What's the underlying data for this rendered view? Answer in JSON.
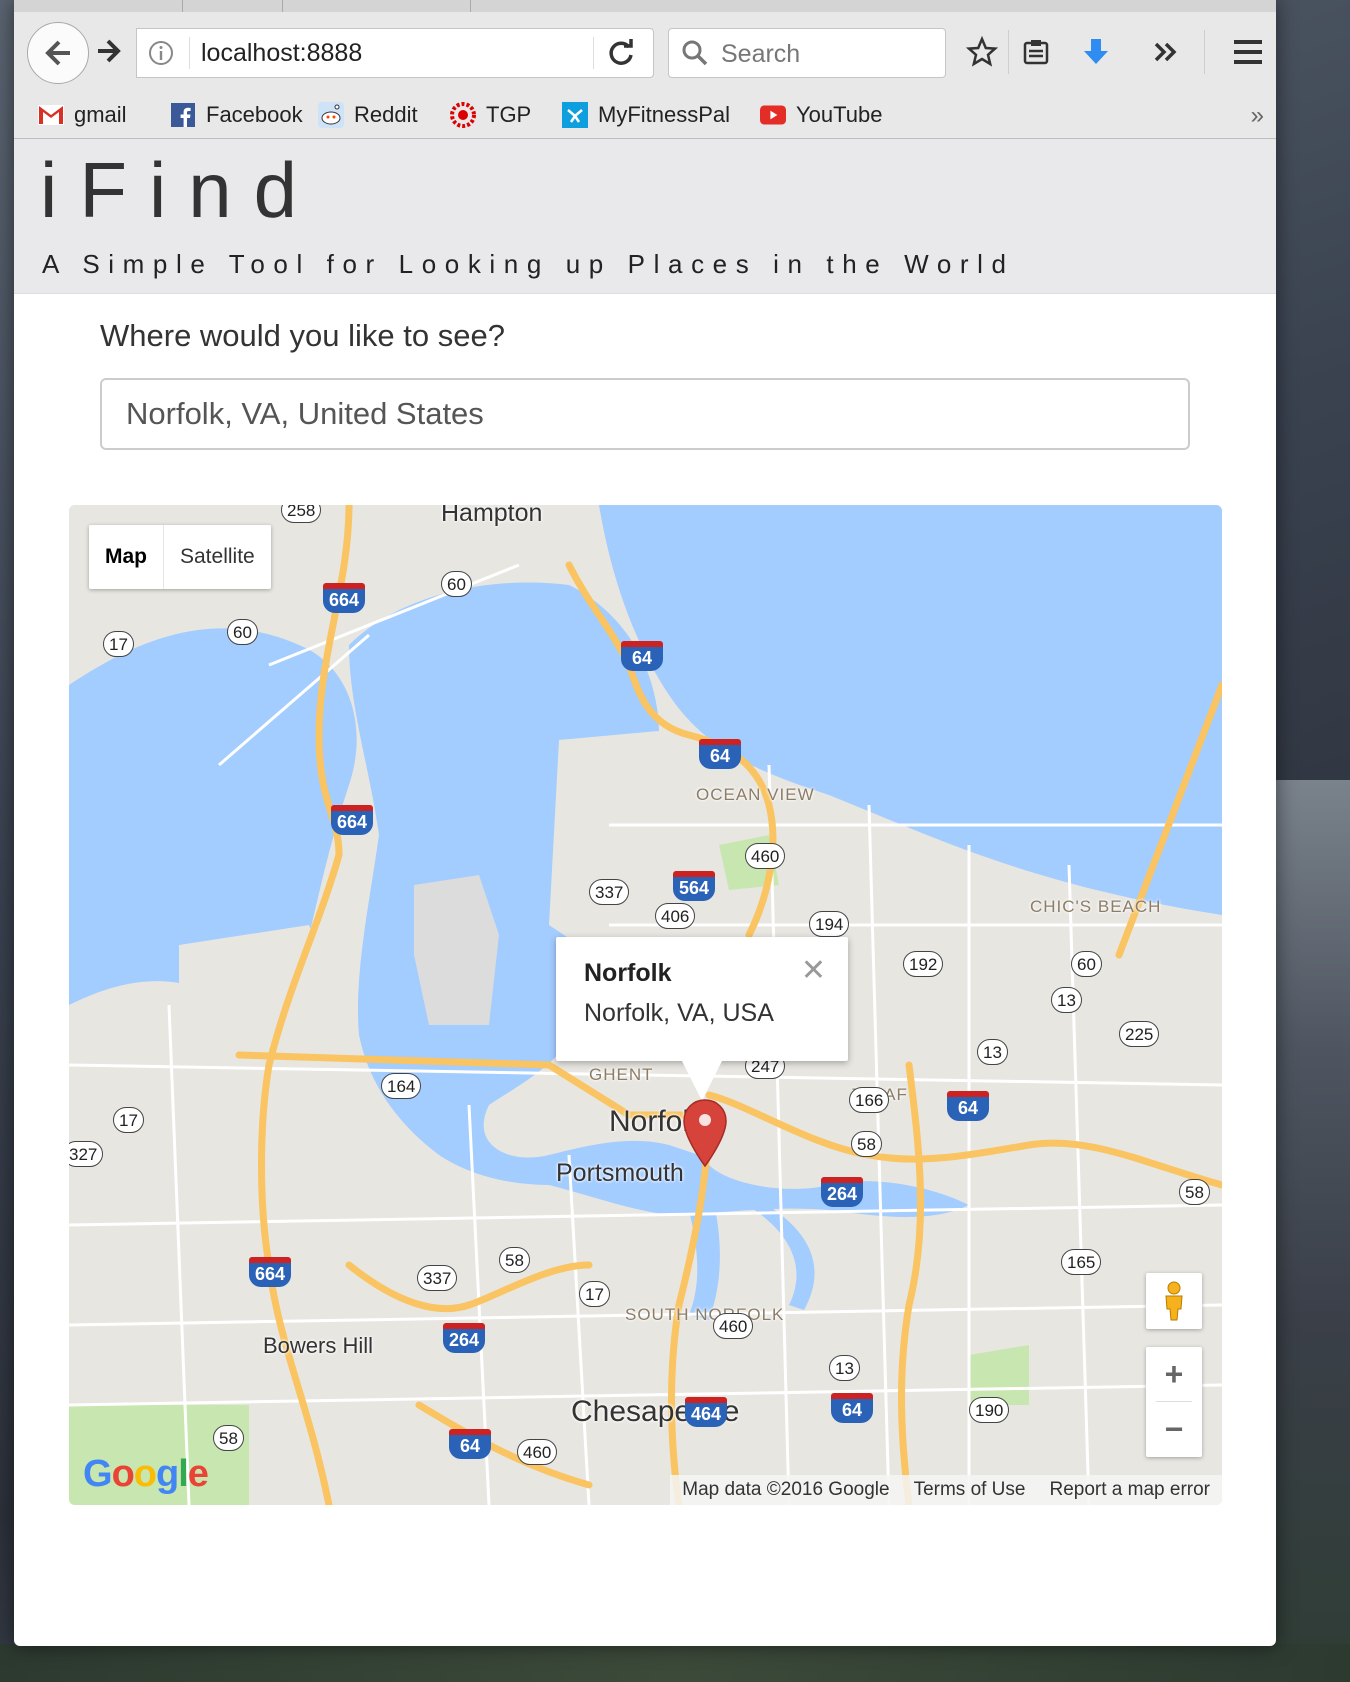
{
  "browser": {
    "url": "localhost:8888",
    "search_placeholder": "Search",
    "bookmarks": [
      {
        "label": "gmail",
        "icon": "gmail-icon"
      },
      {
        "label": "Facebook",
        "icon": "facebook-icon"
      },
      {
        "label": "Reddit",
        "icon": "reddit-icon"
      },
      {
        "label": "TGP",
        "icon": "tgp-icon"
      },
      {
        "label": "MyFitnessPal",
        "icon": "myfitnesspal-icon"
      },
      {
        "label": "YouTube",
        "icon": "youtube-icon"
      }
    ],
    "more_bookmarks": "»"
  },
  "page": {
    "title": "iFind",
    "subtitle": "A Simple Tool for Looking up Places in the World",
    "search_label": "Where would you like to see?",
    "search_value": "Norfolk, VA, United States"
  },
  "map": {
    "type_buttons": {
      "map": "Map",
      "satellite": "Satellite"
    },
    "active_type": "Map",
    "infowindow": {
      "name": "Norfolk",
      "address": "Norfolk, VA, USA",
      "close": "✕"
    },
    "city_labels": [
      "Hampton",
      "Norfolk",
      "Portsmouth",
      "Chesapeake",
      "Bowers Hill"
    ],
    "district_labels": [
      "OCEAN VIEW",
      "CHIC'S BEACH",
      "GHENT",
      "JANAF",
      "SOUTH NORFOLK"
    ],
    "route_shields": [
      "258",
      "60",
      "17",
      "60",
      "664",
      "64",
      "64",
      "664",
      "460",
      "337",
      "564",
      "406",
      "194",
      "192",
      "60",
      "13",
      "225",
      "13",
      "247",
      "166",
      "64",
      "58",
      "58",
      "164",
      "17",
      "327",
      "264",
      "58",
      "337",
      "17",
      "664",
      "264",
      "460",
      "165",
      "13",
      "64",
      "464",
      "190",
      "58",
      "64",
      "460"
    ],
    "zoom": {
      "in": "+",
      "out": "−"
    },
    "footer": {
      "data": "Map data ©2016 Google",
      "terms": "Terms of Use",
      "report": "Report a map error"
    },
    "logo": "Google",
    "colors": {
      "water": "#a3ccff",
      "land": "#e8e6e1",
      "highway": "#f9c461",
      "pin": "#d6433b"
    }
  }
}
